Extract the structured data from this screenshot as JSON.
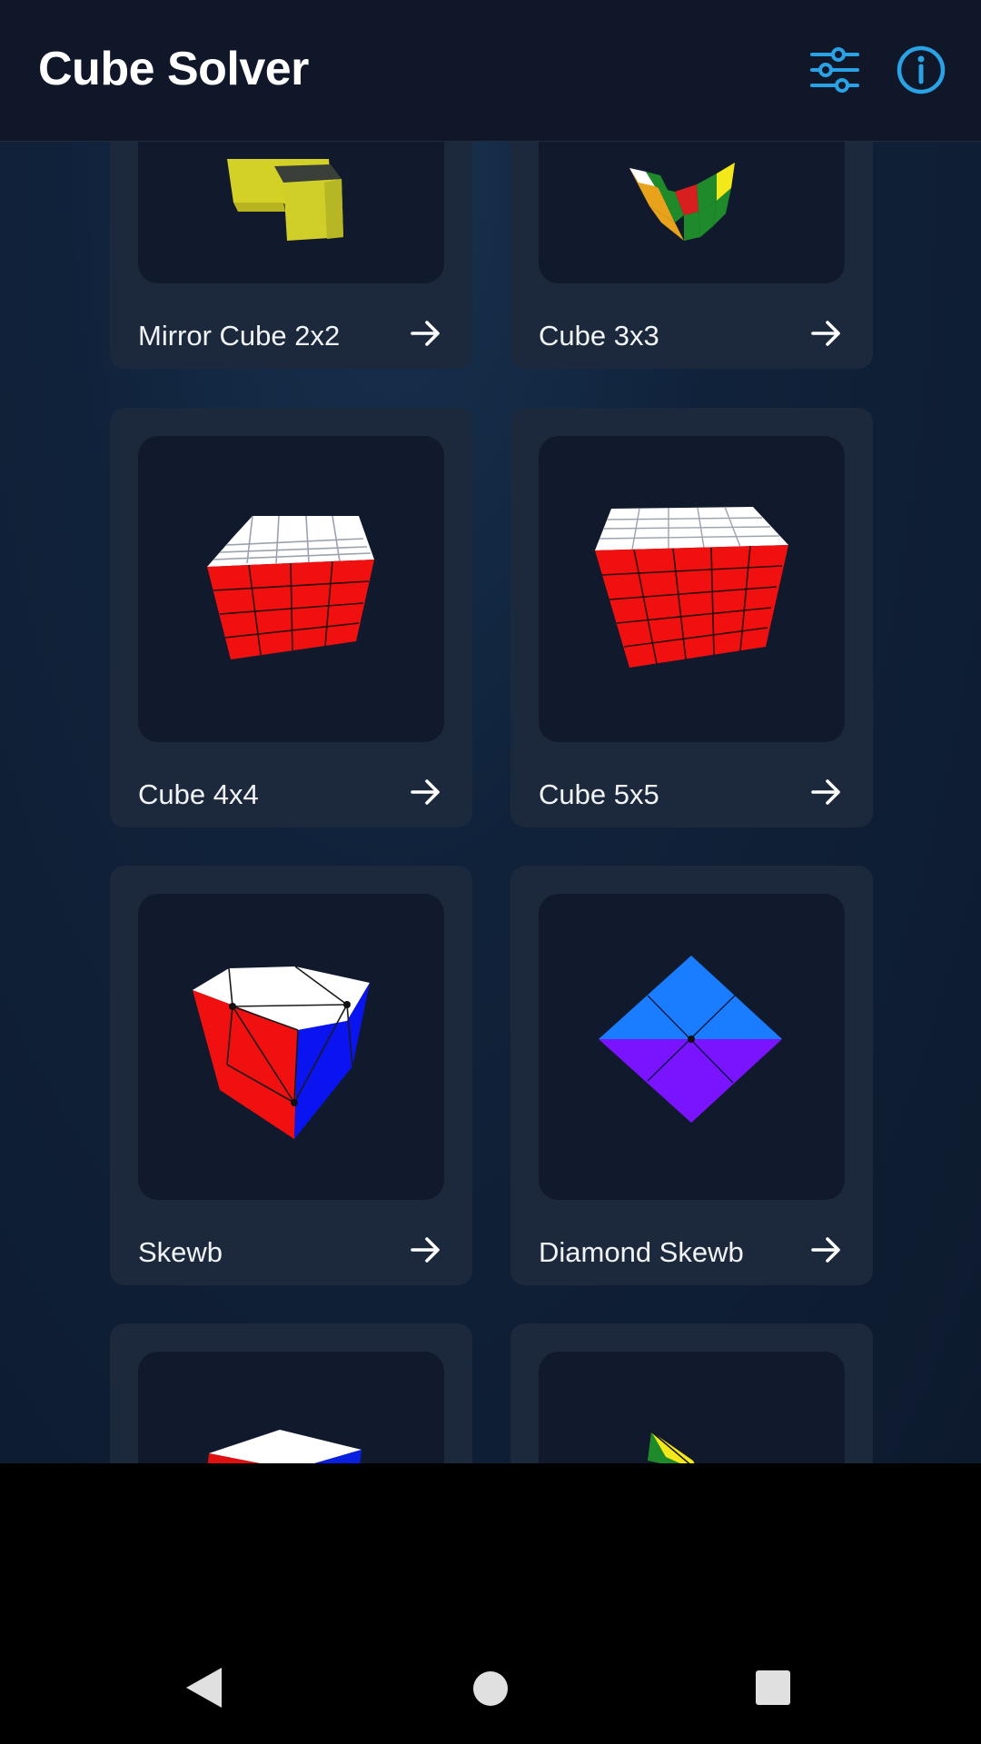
{
  "app_bar": {
    "title": "Cube Solver",
    "settings_icon": "tune-sliders-icon",
    "info_icon": "info-circle-icon",
    "accent_color": "#29a3e6"
  },
  "puzzles": [
    {
      "label": "Mirror Cube 2x2",
      "icon": "arrow-right-icon"
    },
    {
      "label": "Cube 3x3",
      "icon": "arrow-right-icon"
    },
    {
      "label": "Cube 4x4",
      "icon": "arrow-right-icon"
    },
    {
      "label": "Cube 5x5",
      "icon": "arrow-right-icon"
    },
    {
      "label": "Skewb",
      "icon": "arrow-right-icon"
    },
    {
      "label": "Diamond Skewb",
      "icon": "arrow-right-icon"
    },
    {
      "label": "",
      "icon": "arrow-right-icon"
    },
    {
      "label": "",
      "icon": "arrow-right-icon"
    }
  ],
  "system_nav": {
    "back": "back-triangle-icon",
    "home": "home-circle-icon",
    "recents": "recents-square-icon"
  }
}
